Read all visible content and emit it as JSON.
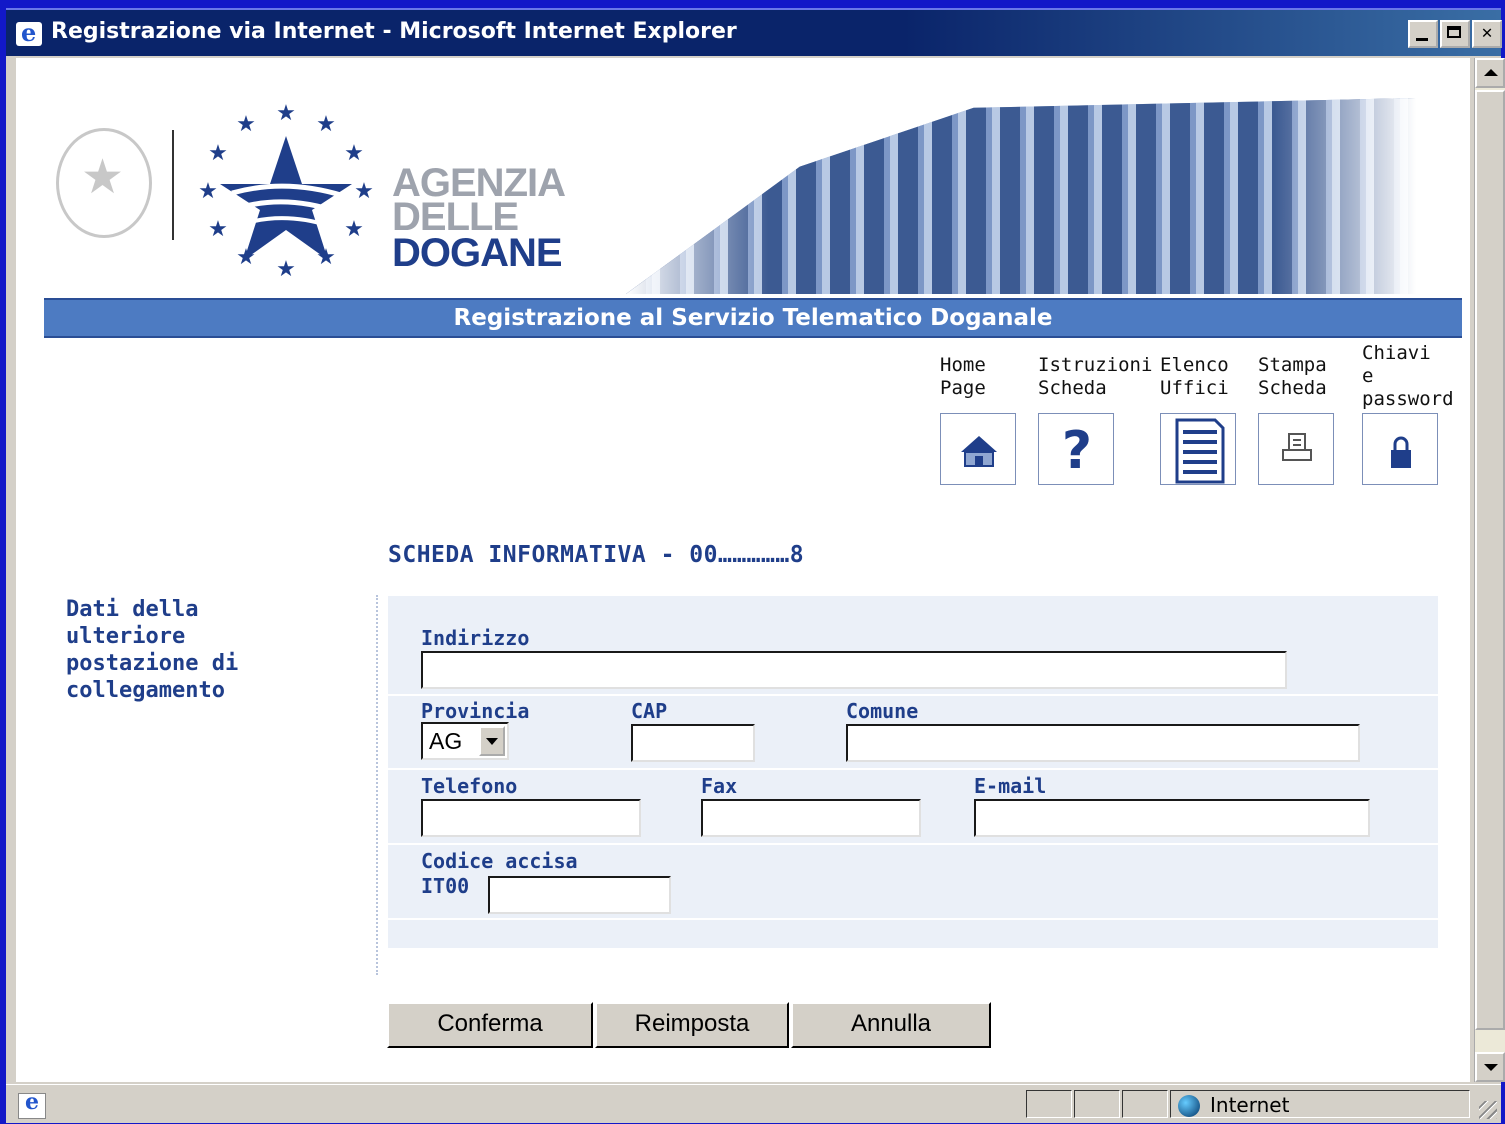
{
  "window": {
    "title": "Registrazione via Internet - Microsoft Internet Explorer"
  },
  "header": {
    "agency_lines": [
      "AGENZIA",
      "DELLE",
      "DOGANE"
    ],
    "banner": "Registrazione al Servizio Telematico Doganale"
  },
  "nav": {
    "items": [
      {
        "label_lines": [
          "Home",
          "Page"
        ],
        "icon": "home-icon"
      },
      {
        "label_lines": [
          "Istruzioni",
          "Scheda"
        ],
        "icon": "help-icon"
      },
      {
        "label_lines": [
          "Elenco",
          "Uffici"
        ],
        "icon": "document-list-icon"
      },
      {
        "label_lines": [
          "Stampa",
          "Scheda"
        ],
        "icon": "printer-icon"
      },
      {
        "label_lines": [
          "Chiavi",
          "e",
          "password"
        ],
        "icon": "lock-icon"
      }
    ]
  },
  "form": {
    "title": "SCHEDA INFORMATIVA - 00……………8",
    "side_title_lines": [
      "Dati della ulteriore",
      "postazione di",
      "collegamento"
    ],
    "indirizzo_label": "Indirizzo",
    "provincia_label": "Provincia",
    "provincia_value": "AG",
    "cap_label": "CAP",
    "comune_label": "Comune",
    "telefono_label": "Telefono",
    "fax_label": "Fax",
    "email_label": "E-mail",
    "codice_accisa_label": "Codice accisa",
    "codice_accisa_prefix": "IT00"
  },
  "buttons": {
    "confirm": "Conferma",
    "reset": "Reimposta",
    "cancel": "Annulla"
  },
  "statusbar": {
    "zone": "Internet"
  },
  "colors": {
    "desktop": "#1218c8",
    "title_bar": "#0a246a",
    "banner": "#4d7bc2",
    "brand_dark": "#1f3e8a",
    "form_panel": "#ebf0f8"
  }
}
